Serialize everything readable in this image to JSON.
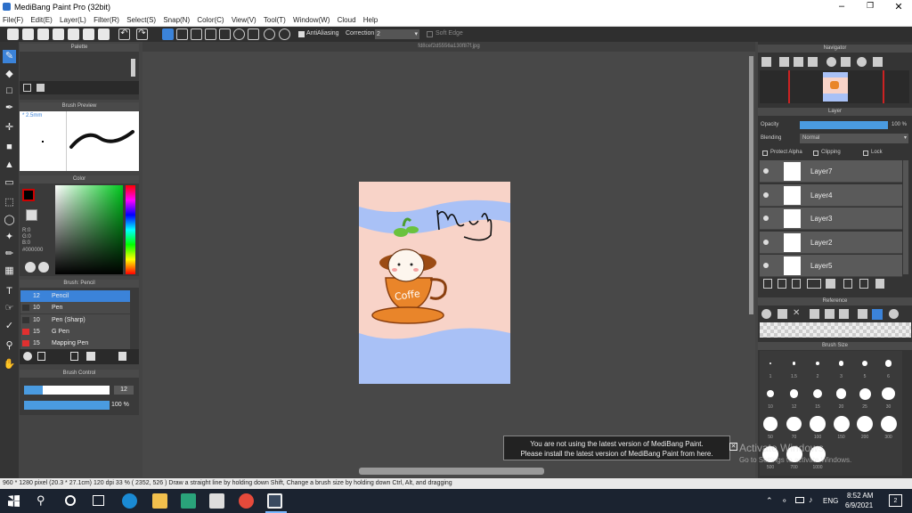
{
  "window": {
    "title": "MediBang Paint Pro (32bit)"
  },
  "menu": [
    "File(F)",
    "Edit(E)",
    "Layer(L)",
    "Filter(R)",
    "Select(S)",
    "Snap(N)",
    "Color(C)",
    "View(V)",
    "Tool(T)",
    "Window(W)",
    "Cloud",
    "Help"
  ],
  "toolbar": {
    "antialias_label": "AntiAliasing",
    "correction_label": "Correction",
    "correction_value": "2",
    "soft_edge_label": "Soft Edge"
  },
  "canvas": {
    "tab_title": "fd8cef2d5556a130f87f.jpg",
    "signature": "Muny",
    "cup_text": "Coffe"
  },
  "panels": {
    "palette": "Palette",
    "brush_preview": "Brush Preview",
    "brush_size_text": "* 2.5mm",
    "color": "Color",
    "rgb": {
      "r": "R:0",
      "g": "G:0",
      "b": "B:0",
      "hex": "#000000"
    },
    "brush_title": "Brush: Pencil",
    "brush_control": "Brush Control",
    "brush_control_size": "12",
    "brush_control_opacity": "100 %",
    "navigator": "Navigator",
    "layer": "Layer",
    "opacity_label": "Opacity",
    "opacity_value": "100 %",
    "blending_label": "Blending",
    "blending_value": "Normal",
    "protect_alpha": "Protect Alpha",
    "clipping": "Clipping",
    "lock": "Lock",
    "reference": "Reference",
    "brush_size": "Brush Size"
  },
  "brushes": [
    {
      "size": "12",
      "name": "Pencil",
      "color": "#3b83d9"
    },
    {
      "size": "10",
      "name": "Pen",
      "color": "#333333"
    },
    {
      "size": "10",
      "name": "Pen (Sharp)",
      "color": "#333333"
    },
    {
      "size": "15",
      "name": "G Pen",
      "color": "#e03030"
    },
    {
      "size": "15",
      "name": "Mapping Pen",
      "color": "#e03030"
    }
  ],
  "layers": [
    "Layer7",
    "Layer4",
    "Layer3",
    "Layer2",
    "Layer5"
  ],
  "brush_sizes": [
    "1",
    "1.5",
    "2",
    "3",
    "5",
    "6",
    "10",
    "12",
    "15",
    "20",
    "25",
    "30",
    "50",
    "70",
    "100",
    "150",
    "200",
    "300",
    "500",
    "700",
    "1000"
  ],
  "notification": {
    "line1": "You are not using the latest version of MediBang Paint.",
    "line2": "Please install the latest version of MediBang Paint from here."
  },
  "watermark": {
    "line1": "Activate Windows",
    "line2": "Go to Settings to activate Windows."
  },
  "status": "960 * 1280 pixel  (20.3 * 27.1cm)  120 dpi  33 %  ( 2352, 526 )  Draw a straight line by holding down Shift, Change a brush size by holding down Ctrl, Alt, and dragging",
  "taskbar": {
    "time": "8:52 AM",
    "date": "6/9/2021",
    "lang": "ENG",
    "notif_count": "2"
  },
  "colors": {
    "canvas_pink": "#f8d3c8",
    "canvas_blue": "#a9c1f6",
    "cup_orange": "#e9852a",
    "accent_blue": "#3b83d9"
  }
}
